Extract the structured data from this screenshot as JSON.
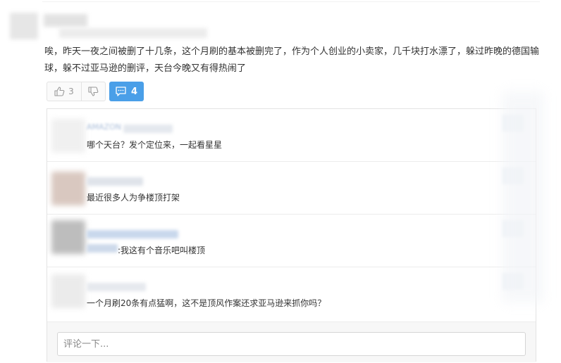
{
  "post": {
    "text": "唉，昨天一夜之间被删了十几条，这个月刷的基本被删完了，作为个人创业的小卖家，几千块打水漂了，躲过昨晚的德国输球，躲不过亚马逊的删评，天台今晚又有得热闹了"
  },
  "actions": {
    "like_count": "3",
    "comment_count": "4"
  },
  "comments": [
    {
      "name": "AMAZON",
      "text": "哪个天台？发个定位来，一起看星星"
    },
    {
      "name": "",
      "text": "最近很多人为争楼顶打架"
    },
    {
      "name": "",
      "text": ":我这有个音乐吧叫楼顶"
    },
    {
      "name": "",
      "text": "一个月刷20条有点猛啊，这不是顶风作案还求亚马逊来抓你吗？"
    }
  ],
  "input": {
    "placeholder": "评论一下..."
  },
  "colors": {
    "accent": "#4a9fe8",
    "border": "#e3e3e3",
    "text": "#333333"
  }
}
